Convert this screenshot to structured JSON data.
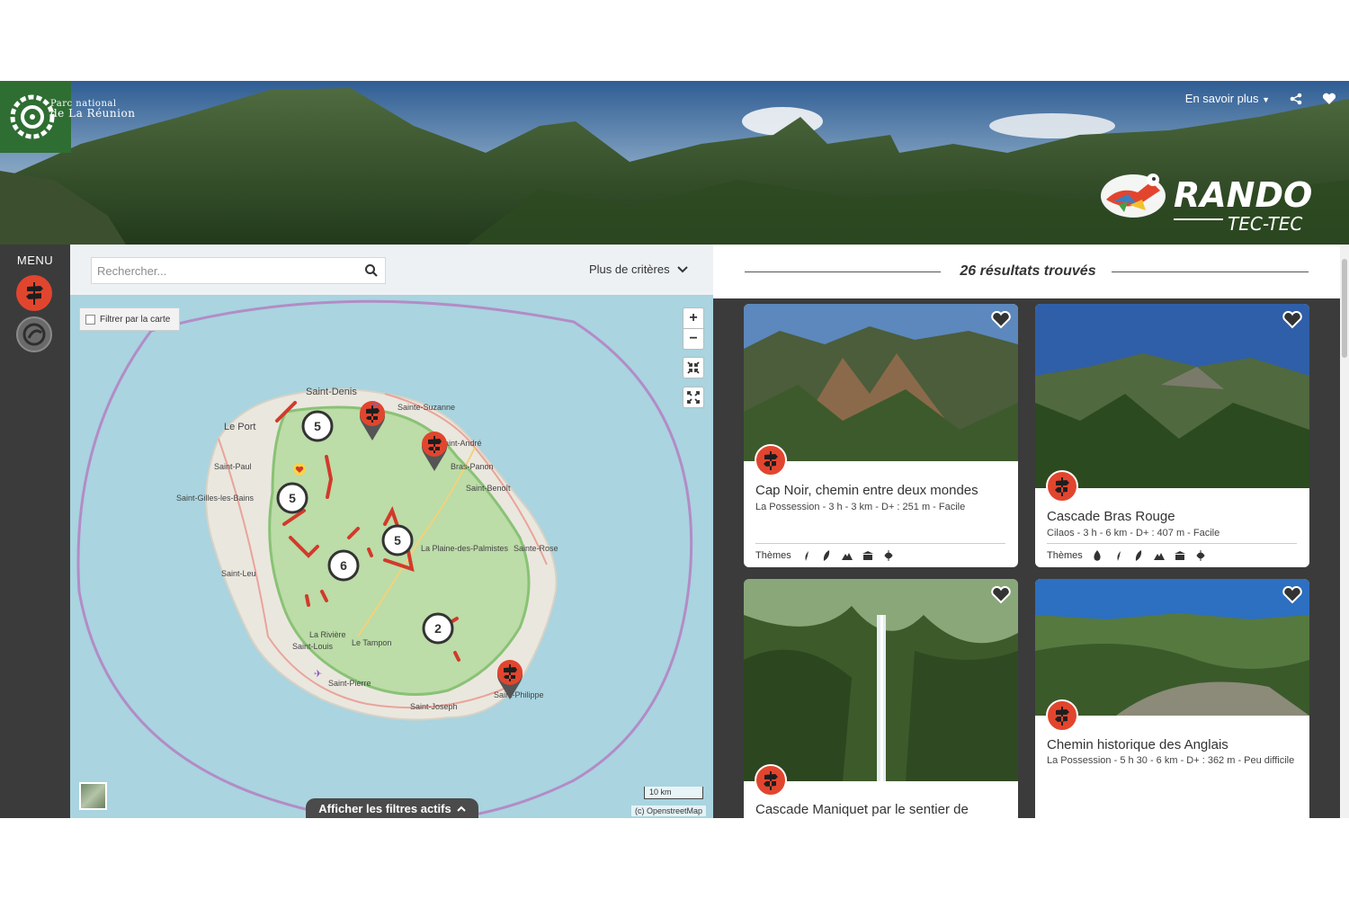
{
  "header": {
    "park_name_line1": "Parc national",
    "park_name_line2": "de La Réunion",
    "learn_more": "En savoir plus",
    "brand_logo_icon": "rando-tec-tec-logo",
    "share_icon": "share-icon",
    "favorite_icon": "heart-icon"
  },
  "sidebar": {
    "menu_label": "MENU",
    "items": [
      {
        "name": "rando-icon",
        "color": "#e2452e"
      },
      {
        "name": "outdoor-icon",
        "color": "#6a6a6a"
      }
    ]
  },
  "map": {
    "search_placeholder": "Rechercher...",
    "more_criteria": "Plus de critères",
    "filter_by_map": "Filtrer par la carte",
    "zoom_in": "+",
    "zoom_out": "−",
    "scale": "10 km",
    "attribution": "(c) OpenstreetMap",
    "active_filters": "Afficher les filtres actifs",
    "places": [
      "Saint-Denis",
      "Sainte-Suzanne",
      "Le Port",
      "Saint-André",
      "Saint-Paul",
      "Bras-Panon",
      "Saint-Benoît",
      "Saint-Gilles-les-Bains",
      "La Plaine-des-Palmistes",
      "Sainte-Rose",
      "Saint-Leu",
      "La Rivière",
      "Le Tampon",
      "Saint-Louis",
      "Saint-Pierre",
      "Saint-Philippe",
      "Saint-Joseph"
    ],
    "clusters": [
      "5",
      "5",
      "5",
      "6",
      "2"
    ],
    "trail_color": "#d23a2a",
    "park_zone_color": "#8fd07a",
    "sea_color": "#a9d4e0"
  },
  "results": {
    "title": "26 résultats trouvés",
    "themes_label": "Thèmes",
    "cards": [
      {
        "title": "Cap Noir, chemin entre deux mondes",
        "meta": "La Possession  -  3 h  -  3 km  -  D+ : 251 m  -  Facile"
      },
      {
        "title": "Cascade Bras Rouge",
        "meta": "Cilaos  -  3 h  -  6 km  -  D+ : 407 m  -  Facile"
      },
      {
        "title": "Cascade Maniquet par le sentier de",
        "meta": ""
      },
      {
        "title": "Chemin historique des Anglais",
        "meta": "La Possession  -  5 h 30  -  6 km  -  D+ : 362 m  -  Peu difficile"
      }
    ]
  }
}
